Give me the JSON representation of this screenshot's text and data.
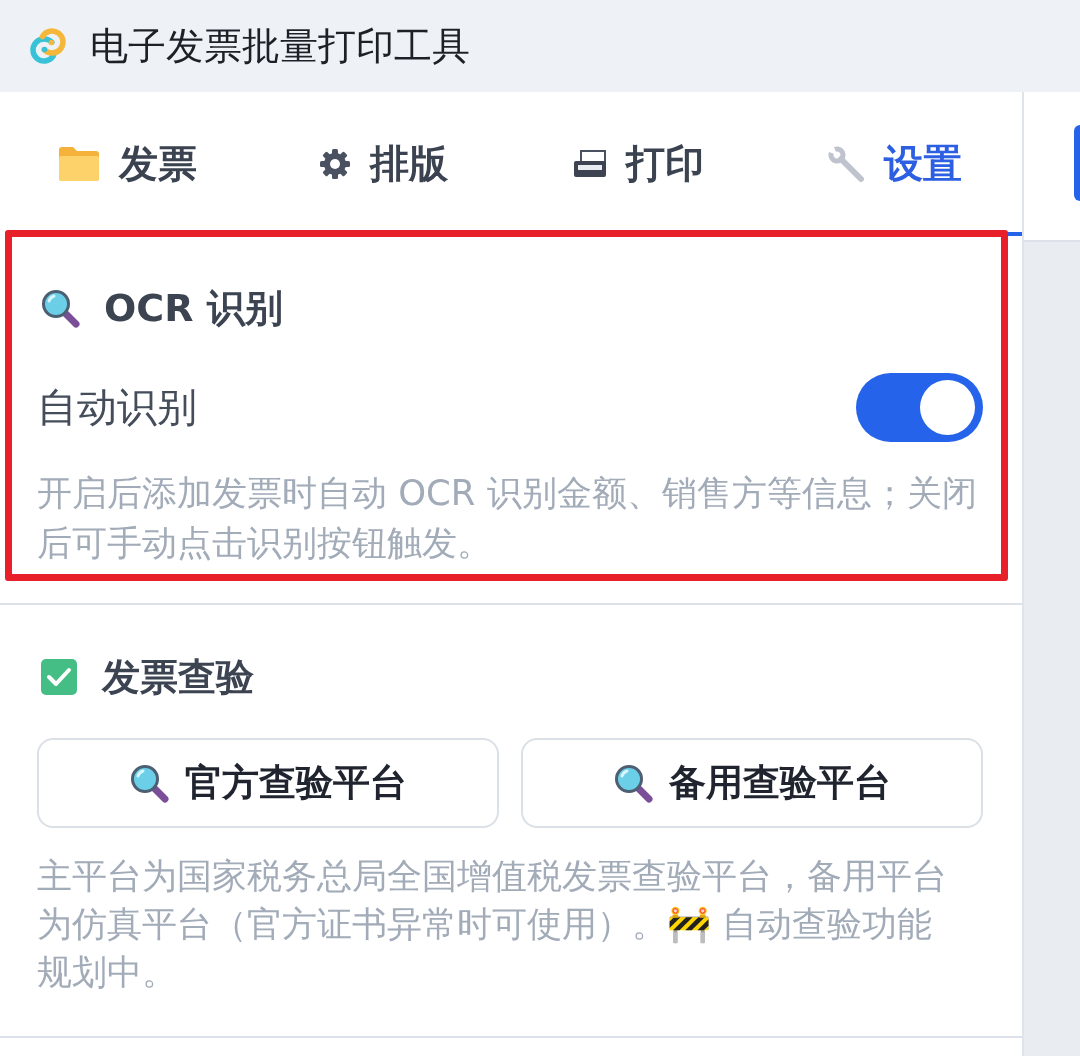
{
  "window": {
    "title": "电子发票批量打印工具"
  },
  "tabs": [
    {
      "label": "发票",
      "selected": false
    },
    {
      "label": "排版",
      "selected": false
    },
    {
      "label": "打印",
      "selected": false
    },
    {
      "label": "设置",
      "selected": true
    }
  ],
  "sections": [
    {
      "kind": "toggle",
      "title": "OCR 识别",
      "highlighted": true,
      "setting": {
        "label": "自动识别",
        "on": true
      },
      "description": "开启后添加发票时自动 OCR 识别金额、销售方等信息；关闭后可手动点击识别按钮触发。"
    },
    {
      "kind": "buttons",
      "title": "发票查验",
      "highlighted": false,
      "buttons": [
        "官方查验平台",
        "备用查验平台"
      ],
      "description": "主平台为国家税务总局全国增值税发票查验平台，备用平台为仿真平台（官方证书异常时可使用）。🚧 自动查验功能规划中。"
    }
  ]
}
